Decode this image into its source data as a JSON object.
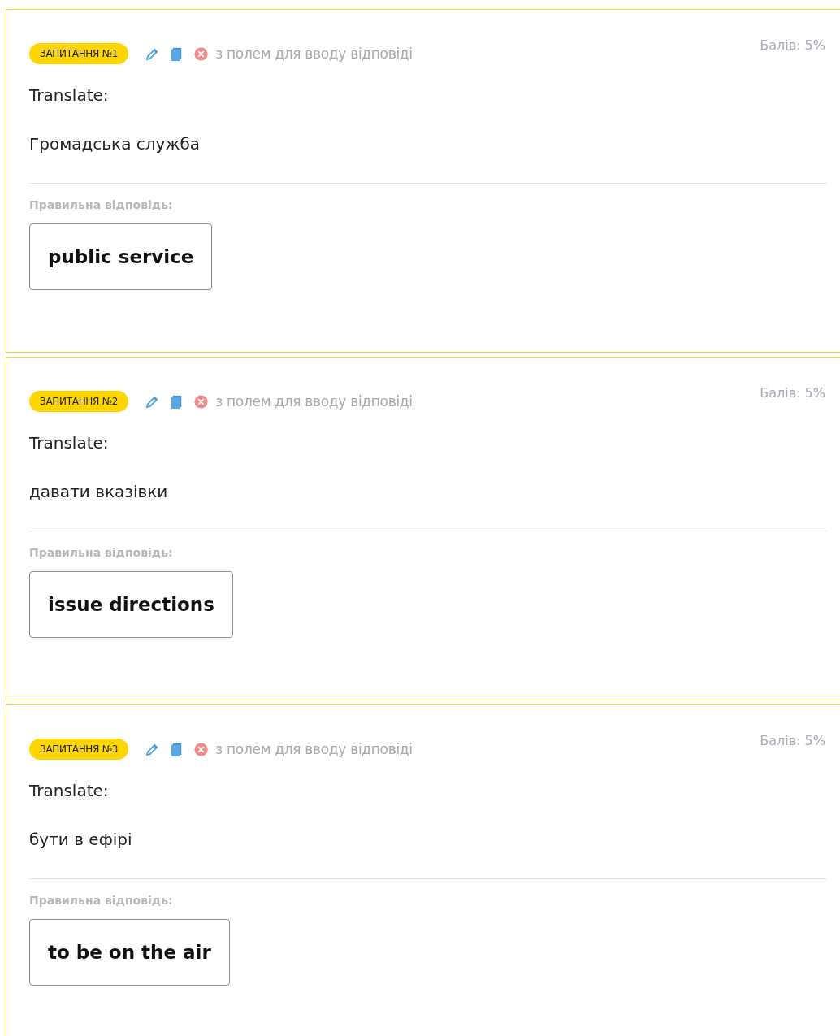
{
  "questions": [
    {
      "badge": "ЗАПИТАННЯ №1",
      "type": "з полем для вводу відповіді",
      "score": "Балів: 5%",
      "instruction": "Translate:",
      "prompt": "Громадська служба",
      "answer_label": "Правильна відповідь:",
      "answer": "public service"
    },
    {
      "badge": "ЗАПИТАННЯ №2",
      "type": "з полем для вводу відповіді",
      "score": "Балів: 5%",
      "instruction": "Translate:",
      "prompt": "давати вказівки",
      "answer_label": "Правильна відповідь:",
      "answer": "issue directions"
    },
    {
      "badge": "ЗАПИТАННЯ №3",
      "type": "з полем для вводу відповіді",
      "score": "Балів: 5%",
      "instruction": "Translate:",
      "prompt": "бути в ефірі",
      "answer_label": "Правильна відповідь:",
      "answer": "to be on the air"
    }
  ]
}
